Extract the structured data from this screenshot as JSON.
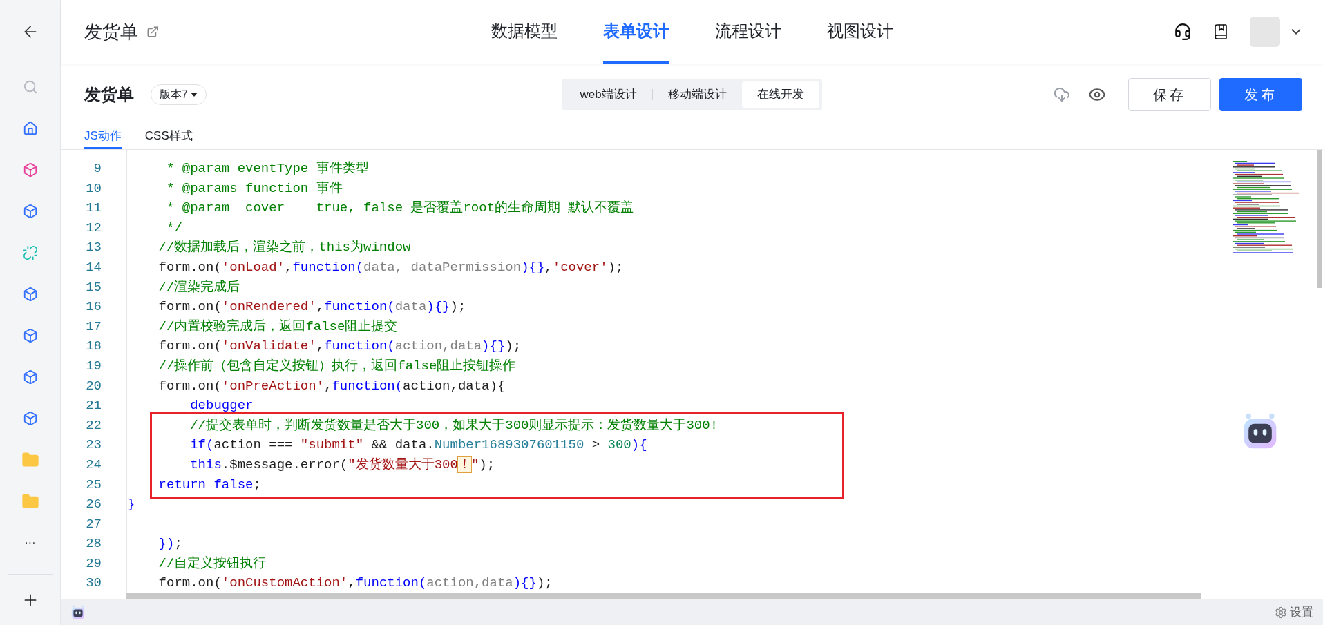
{
  "sidebar": {
    "items": [
      {
        "kind": "search",
        "color": "#b4b8bf"
      },
      {
        "kind": "home",
        "color": "#3370ff"
      },
      {
        "kind": "cube",
        "color": "#e8409a"
      },
      {
        "kind": "cube",
        "color": "#3370ff"
      },
      {
        "kind": "link",
        "color": "#1cbfb0"
      },
      {
        "kind": "cube",
        "color": "#3370ff"
      },
      {
        "kind": "cube",
        "color": "#3370ff"
      },
      {
        "kind": "cube",
        "color": "#3370ff"
      },
      {
        "kind": "cube",
        "color": "#3370ff"
      },
      {
        "kind": "folder",
        "color": "#fcc844"
      },
      {
        "kind": "folder",
        "color": "#fcc844"
      },
      {
        "kind": "more",
        "text": "···"
      }
    ]
  },
  "header": {
    "title": "发货单",
    "tabs": [
      {
        "label": "数据模型",
        "selected": false
      },
      {
        "label": "表单设计",
        "selected": true
      },
      {
        "label": "流程设计",
        "selected": false
      },
      {
        "label": "视图设计",
        "selected": false
      }
    ]
  },
  "toolbar": {
    "title": "发货单",
    "version": "版本7",
    "modes": [
      {
        "label": "web端设计",
        "selected": false
      },
      {
        "label": "移动端设计",
        "selected": false
      },
      {
        "label": "在线开发",
        "selected": true
      }
    ],
    "buttons": [
      {
        "label": "保存",
        "kind": "secondary"
      },
      {
        "label": "发布",
        "kind": "primary"
      }
    ]
  },
  "editor_tabs": [
    {
      "label": "JS动作",
      "selected": true
    },
    {
      "label": "CSS样式",
      "selected": false
    }
  ],
  "code": {
    "blocks": [
      {
        "highlighted": false,
        "lines": [
          {
            "number": "9",
            "tokens": [
              {
                "kind": "comment",
                "text": "     * @param eventType 事件类型"
              }
            ]
          },
          {
            "number": "10",
            "tokens": [
              {
                "kind": "comment",
                "text": "     * @params function 事件"
              }
            ]
          },
          {
            "number": "11",
            "tokens": [
              {
                "kind": "comment",
                "text": "     * @param  cover    true, false 是否覆盖root的生命周期 默认不覆盖"
              }
            ]
          },
          {
            "number": "12",
            "tokens": [
              {
                "kind": "comment",
                "text": "     */"
              }
            ]
          },
          {
            "number": "13",
            "tokens": [
              {
                "kind": "comment",
                "text": "    //数据加载后，渲染之前，this为window"
              }
            ]
          },
          {
            "number": "14",
            "tokens": [
              {
                "kind": "plain",
                "text": "    form.on("
              },
              {
                "kind": "string",
                "text": "'onLoad'"
              },
              {
                "kind": "plain",
                "text": ","
              },
              {
                "kind": "keyword",
                "text": "function("
              },
              {
                "kind": "param",
                "text": "data, dataPermission"
              },
              {
                "kind": "keyword",
                "text": "){}"
              },
              {
                "kind": "plain",
                "text": ","
              },
              {
                "kind": "string",
                "text": "'cover'"
              },
              {
                "kind": "plain",
                "text": ");"
              }
            ]
          },
          {
            "number": "15",
            "tokens": [
              {
                "kind": "comment",
                "text": "    //渲染完成后"
              }
            ]
          },
          {
            "number": "16",
            "tokens": [
              {
                "kind": "plain",
                "text": "    form.on("
              },
              {
                "kind": "string",
                "text": "'onRendered'"
              },
              {
                "kind": "plain",
                "text": ","
              },
              {
                "kind": "keyword",
                "text": "function("
              },
              {
                "kind": "param",
                "text": "data"
              },
              {
                "kind": "keyword",
                "text": "){}"
              },
              {
                "kind": "plain",
                "text": ");"
              }
            ]
          },
          {
            "number": "17",
            "tokens": [
              {
                "kind": "comment",
                "text": "    //内置校验完成后，返回false阻止提交"
              }
            ]
          },
          {
            "number": "18",
            "tokens": [
              {
                "kind": "plain",
                "text": "    form.on("
              },
              {
                "kind": "string",
                "text": "'onValidate'"
              },
              {
                "kind": "plain",
                "text": ","
              },
              {
                "kind": "keyword",
                "text": "function("
              },
              {
                "kind": "param",
                "text": "action,data"
              },
              {
                "kind": "keyword",
                "text": "){}"
              },
              {
                "kind": "plain",
                "text": ");"
              }
            ]
          },
          {
            "number": "19",
            "tokens": [
              {
                "kind": "comment",
                "text": "    //操作前（包含自定义按钮）执行，返回false阻止按钮操作"
              }
            ]
          },
          {
            "number": "20",
            "tokens": [
              {
                "kind": "plain",
                "text": "    form.on("
              },
              {
                "kind": "string",
                "text": "'onPreAction'"
              },
              {
                "kind": "plain",
                "text": ","
              },
              {
                "kind": "keyword",
                "text": "function("
              },
              {
                "kind": "plain",
                "text": "action,data){"
              }
            ]
          },
          {
            "number": "21",
            "tokens": [
              {
                "kind": "keyword",
                "text": "        debugger"
              }
            ]
          }
        ]
      },
      {
        "highlighted": true,
        "lines": [
          {
            "number": "22",
            "tokens": [
              {
                "kind": "comment",
                "text": "        //提交表单时，判断发货数量是否大于300，如果大于300则显示提示：发货数量大于300!"
              }
            ]
          },
          {
            "number": "23",
            "tokens": [
              {
                "kind": "keyword",
                "text": "        if("
              },
              {
                "kind": "plain",
                "text": "action === "
              },
              {
                "kind": "string",
                "text": "\"submit\""
              },
              {
                "kind": "plain",
                "text": " && data."
              },
              {
                "kind": "type",
                "text": "Number1689307601150"
              },
              {
                "kind": "plain",
                "text": " > "
              },
              {
                "kind": "number",
                "text": "300"
              },
              {
                "kind": "keyword",
                "text": "){"
              }
            ]
          },
          {
            "number": "24",
            "tokens": [
              {
                "kind": "keyword",
                "text": "        this"
              },
              {
                "kind": "plain",
                "text": ".$message.error("
              },
              {
                "kind": "string",
                "text": "\"发货数量大于300"
              },
              {
                "kind": "match",
                "text": "！"
              },
              {
                "kind": "string",
                "text": "\""
              },
              {
                "kind": "plain",
                "text": ");"
              }
            ]
          },
          {
            "number": "25",
            "tokens": [
              {
                "kind": "keyword",
                "text": "    return false"
              },
              {
                "kind": "plain",
                "text": ";"
              }
            ]
          }
        ]
      },
      {
        "highlighted": false,
        "lines": [
          {
            "number": "26",
            "tokens": [
              {
                "kind": "keyword",
                "text": "}"
              }
            ]
          },
          {
            "number": "27"
          },
          {
            "number": "28",
            "tokens": [
              {
                "kind": "keyword",
                "text": "    })"
              },
              {
                "kind": "plain",
                "text": ";"
              }
            ]
          },
          {
            "number": "29",
            "tokens": [
              {
                "kind": "comment",
                "text": "    //自定义按钮执行"
              }
            ]
          },
          {
            "number": "30",
            "tokens": [
              {
                "kind": "plain",
                "text": "    form.on("
              },
              {
                "kind": "string",
                "text": "'onCustomAction'"
              },
              {
                "kind": "plain",
                "text": ","
              },
              {
                "kind": "keyword",
                "text": "function("
              },
              {
                "kind": "param",
                "text": "action,data"
              },
              {
                "kind": "keyword",
                "text": "){}"
              },
              {
                "kind": "plain",
                "text": ");"
              }
            ]
          }
        ]
      }
    ]
  },
  "status_bar": {
    "settings": "设置"
  }
}
